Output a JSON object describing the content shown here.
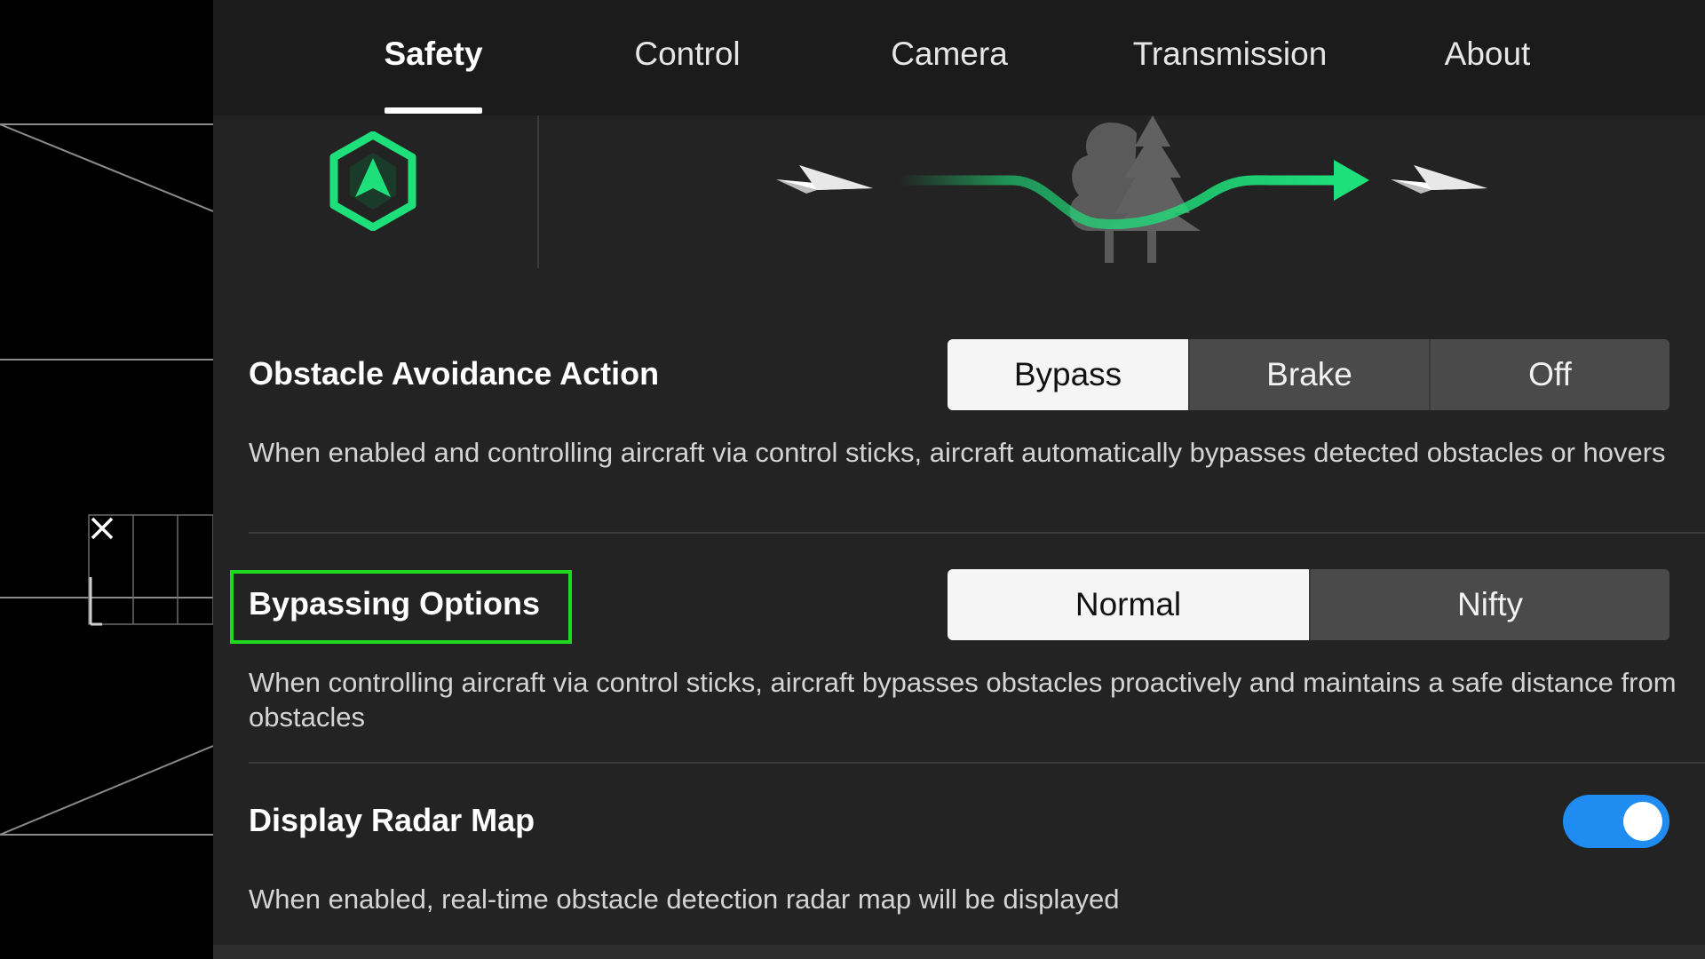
{
  "tabs": [
    {
      "label": "Safety",
      "active": true
    },
    {
      "label": "Control",
      "active": false
    },
    {
      "label": "Camera",
      "active": false
    },
    {
      "label": "Transmission",
      "active": false
    },
    {
      "label": "About",
      "active": false
    }
  ],
  "obstacle_avoidance": {
    "title": "Obstacle Avoidance Action",
    "options": [
      "Bypass",
      "Brake",
      "Off"
    ],
    "selected": "Bypass",
    "description": "When enabled and controlling aircraft via control sticks, aircraft automatically bypasses detected obstacles or hovers"
  },
  "bypassing_options": {
    "title": "Bypassing Options",
    "options": [
      "Normal",
      "Nifty"
    ],
    "selected": "Normal",
    "description": "When controlling aircraft via control sticks, aircraft bypasses obstacles proactively and maintains a safe distance from obstacles"
  },
  "radar_map": {
    "title": "Display Radar Map",
    "enabled": true,
    "description": "When enabled, real-time obstacle detection radar map will be displayed"
  },
  "colors": {
    "accent_green": "#1ee07a",
    "toggle_blue": "#1e8cf0",
    "highlight_green": "#1ed91e"
  },
  "icons": {
    "obstacle": "obstacle-avoidance-hexagon-icon",
    "close": "close-icon"
  }
}
